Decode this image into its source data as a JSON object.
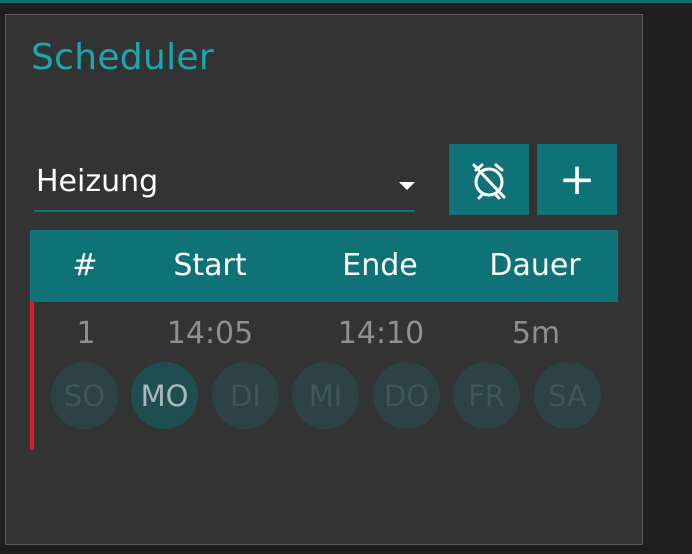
{
  "widget": {
    "title": "Scheduler",
    "select": {
      "value": "Heizung"
    },
    "buttons": {
      "alarm_icon": "alarm-off-icon",
      "add_label": "+"
    }
  },
  "table": {
    "headers": [
      "#",
      "Start",
      "Ende",
      "Dauer"
    ],
    "rows": [
      {
        "index": "1",
        "start": "14:05",
        "end": "14:10",
        "duration": "5m"
      }
    ]
  },
  "days": [
    {
      "label": "SO",
      "active": false
    },
    {
      "label": "MO",
      "active": true
    },
    {
      "label": "DI",
      "active": false
    },
    {
      "label": "MI",
      "active": false
    },
    {
      "label": "DO",
      "active": false
    },
    {
      "label": "FR",
      "active": false
    },
    {
      "label": "SA",
      "active": false
    }
  ],
  "colors": {
    "accent": "#0e7277",
    "title": "#1aa7b0",
    "panel": "#333333",
    "marker": "#e11a1a"
  }
}
